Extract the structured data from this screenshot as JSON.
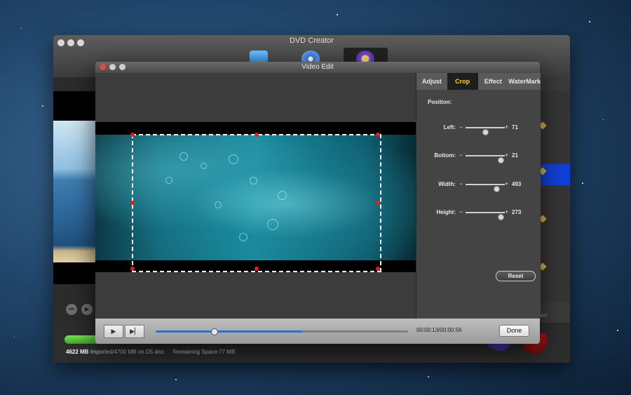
{
  "back_window": {
    "title": "DVD Creator",
    "capacity_used": "4622 MB",
    "capacity_detail": "Imported/4700 MB on D5 disc",
    "remaining": "Remaining Space:77 MB",
    "capacity_fraction": 0.983,
    "burn_label": "own"
  },
  "front_window": {
    "title": "Video Edit",
    "tabs": [
      "Adjust",
      "Crop",
      "Effect",
      "WaterMark"
    ],
    "active_tab": "Crop",
    "position_label": "Position:",
    "sliders": [
      {
        "label": "Left:",
        "value": "71"
      },
      {
        "label": "Bottom:",
        "value": "21"
      },
      {
        "label": "Width:",
        "value": "493"
      },
      {
        "label": "Height:",
        "value": "273"
      }
    ],
    "reset_label": "Reset",
    "time": "00:00:13/00:00:56",
    "done_label": "Done",
    "play_icon": "play-icon",
    "step_icon": "play-frame-icon",
    "playback_fraction": 0.23
  },
  "colors": {
    "accent_blue": "#2f6ed8",
    "active_tab_text": "#f2d52a",
    "crop_handle": "#e02020"
  }
}
